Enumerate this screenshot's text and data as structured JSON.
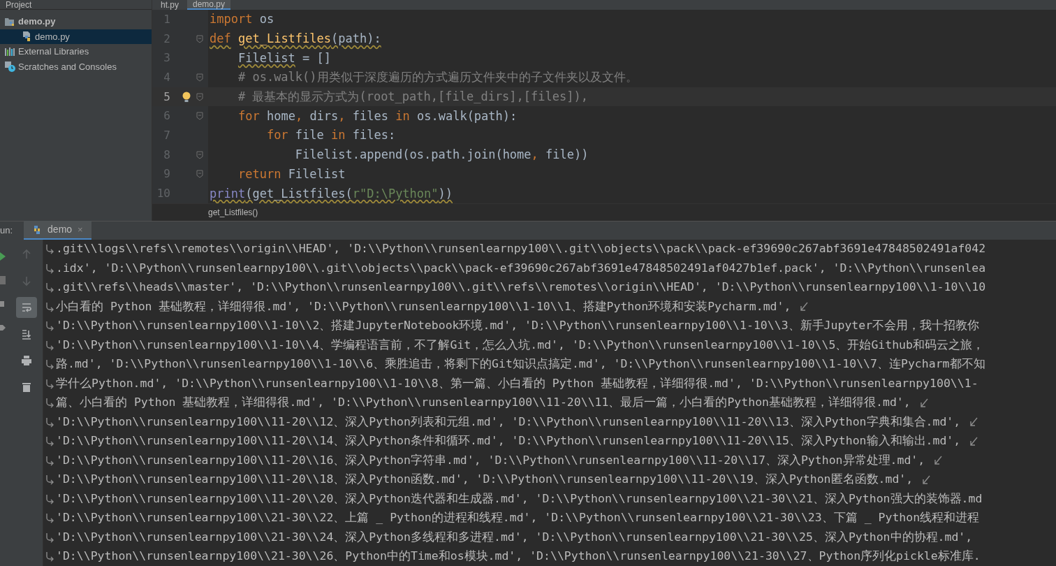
{
  "project_panel": {
    "title": "Project",
    "tree": [
      {
        "label": "demo.py",
        "kind": "folder",
        "selected": false,
        "children": [
          {
            "label": "demo.py",
            "kind": "python",
            "selected": true
          }
        ]
      },
      {
        "label": "External Libraries",
        "kind": "library",
        "selected": false
      },
      {
        "label": "Scratches and Consoles",
        "kind": "scratch",
        "selected": false
      }
    ]
  },
  "editor_tabs": [
    {
      "label": "ht.py",
      "selected": false
    },
    {
      "label": "demo.py",
      "selected": true
    }
  ],
  "code_lines": [
    {
      "number": "1",
      "current": false,
      "fold": false,
      "bulb": false,
      "tokens": [
        {
          "kind": "keyword",
          "text": "import",
          "warning": false
        },
        {
          "kind": "plain",
          "text": " os",
          "warning": false
        }
      ]
    },
    {
      "number": "2",
      "current": false,
      "fold": true,
      "bulb": false,
      "tokens": [
        {
          "kind": "keyword",
          "text": "def",
          "warning": true
        },
        {
          "kind": "function",
          "text": " get_Listfiles",
          "warning": true
        },
        {
          "kind": "plain",
          "text": "(path):",
          "warning": true
        }
      ]
    },
    {
      "number": "3",
      "current": false,
      "fold": false,
      "bulb": false,
      "tokens": [
        {
          "kind": "plain",
          "text": "    Filelist",
          "warning": true
        },
        {
          "kind": "plain",
          "text": " = []",
          "warning": false
        }
      ]
    },
    {
      "number": "4",
      "current": false,
      "fold": true,
      "bulb": false,
      "tokens": [
        {
          "kind": "comment",
          "text": "    # os.walk()用类似于深度遍历的方式遍历文件夹中的子文件夹以及文件。",
          "warning": false
        }
      ]
    },
    {
      "number": "5",
      "current": true,
      "fold": true,
      "bulb": true,
      "tokens": [
        {
          "kind": "comment",
          "text": "    # 最基本的显示方式为(root_path,[file_dirs],[files]),",
          "warning": false
        }
      ]
    },
    {
      "number": "6",
      "current": false,
      "fold": true,
      "bulb": false,
      "tokens": [
        {
          "kind": "keyword",
          "text": "    for",
          "warning": false
        },
        {
          "kind": "plain",
          "text": " home",
          "warning": false
        },
        {
          "kind": "keyword",
          "text": ",",
          "warning": false
        },
        {
          "kind": "plain",
          "text": " dirs",
          "warning": false
        },
        {
          "kind": "keyword",
          "text": ",",
          "warning": false
        },
        {
          "kind": "plain",
          "text": " files ",
          "warning": false
        },
        {
          "kind": "keyword",
          "text": "in",
          "warning": false
        },
        {
          "kind": "plain",
          "text": " os.walk(path):",
          "warning": false
        }
      ]
    },
    {
      "number": "7",
      "current": false,
      "fold": false,
      "bulb": false,
      "tokens": [
        {
          "kind": "keyword",
          "text": "        for",
          "warning": false
        },
        {
          "kind": "plain",
          "text": " file ",
          "warning": false
        },
        {
          "kind": "keyword",
          "text": "in",
          "warning": false
        },
        {
          "kind": "plain",
          "text": " files:",
          "warning": false
        }
      ]
    },
    {
      "number": "8",
      "current": false,
      "fold": true,
      "bulb": false,
      "tokens": [
        {
          "kind": "plain",
          "text": "            Filelist.append(os.path.join(home",
          "warning": false
        },
        {
          "kind": "keyword",
          "text": ",",
          "warning": false
        },
        {
          "kind": "plain",
          "text": " file))",
          "warning": false
        }
      ]
    },
    {
      "number": "9",
      "current": false,
      "fold": true,
      "bulb": false,
      "tokens": [
        {
          "kind": "keyword",
          "text": "    return",
          "warning": false
        },
        {
          "kind": "plain",
          "text": " Filelist",
          "warning": false
        }
      ]
    },
    {
      "number": "10",
      "current": false,
      "fold": false,
      "bulb": false,
      "tokens": [
        {
          "kind": "builtin",
          "text": "print",
          "warning": true
        },
        {
          "kind": "plain",
          "text": "(get_Listfiles(",
          "warning": true
        },
        {
          "kind": "string",
          "text": "r\"D:\\Python\"",
          "warning": true
        },
        {
          "kind": "plain",
          "text": "))",
          "warning": true
        }
      ]
    }
  ],
  "breadcrumb": "get_Listfiles()",
  "run_panel": {
    "label": "un:",
    "tab": "demo",
    "tab_close": "×",
    "toolbar": [
      {
        "kind": "up",
        "disabled": true,
        "selected": false
      },
      {
        "kind": "down",
        "disabled": true,
        "selected": false
      },
      {
        "kind": "wrap",
        "disabled": false,
        "selected": true
      },
      {
        "kind": "scroll-end",
        "disabled": false,
        "selected": false
      },
      {
        "kind": "print",
        "disabled": false,
        "selected": false
      },
      {
        "kind": "trash",
        "disabled": false,
        "selected": false
      }
    ],
    "output": [
      {
        "text": ".git\\\\logs\\\\refs\\\\remotes\\\\origin\\\\HEAD', 'D:\\\\Python\\\\runsenlearnpy100\\\\.git\\\\objects\\\\pack\\\\pack-ef39690c267abf3691e47848502491af042",
        "wrap_end": false
      },
      {
        "text": ".idx', 'D:\\\\Python\\\\runsenlearnpy100\\\\.git\\\\objects\\\\pack\\\\pack-ef39690c267abf3691e47848502491af0427b1ef.pack', 'D:\\\\Python\\\\runsenlea",
        "wrap_end": false
      },
      {
        "text": ".git\\\\refs\\\\heads\\\\master', 'D:\\\\Python\\\\runsenlearnpy100\\\\.git\\\\refs\\\\remotes\\\\origin\\\\HEAD', 'D:\\\\Python\\\\runsenlearnpy100\\\\1-10\\\\10",
        "wrap_end": false
      },
      {
        "text": "小白看的 Python 基础教程，详细得很.md', 'D:\\\\Python\\\\runsenlearnpy100\\\\1-10\\\\1、搭建Python环境和安装Pycharm.md', ",
        "wrap_end": true
      },
      {
        "text": "'D:\\\\Python\\\\runsenlearnpy100\\\\1-10\\\\2、搭建JupyterNotebook环境.md', 'D:\\\\Python\\\\runsenlearnpy100\\\\1-10\\\\3、新手Jupyter不会用，我十招教你",
        "wrap_end": false
      },
      {
        "text": "'D:\\\\Python\\\\runsenlearnpy100\\\\1-10\\\\4、学编程语言前，不了解Git，怎么入坑.md', 'D:\\\\Python\\\\runsenlearnpy100\\\\1-10\\\\5、开始Github和码云之旅，",
        "wrap_end": false
      },
      {
        "text": "路.md', 'D:\\\\Python\\\\runsenlearnpy100\\\\1-10\\\\6、乘胜追击，将剩下的Git知识点搞定.md', 'D:\\\\Python\\\\runsenlearnpy100\\\\1-10\\\\7、连Pycharm都不知",
        "wrap_end": false
      },
      {
        "text": "学什么Python.md', 'D:\\\\Python\\\\runsenlearnpy100\\\\1-10\\\\8、第一篇、小白看的 Python 基础教程，详细得很.md', 'D:\\\\Python\\\\runsenlearnpy100\\\\1-",
        "wrap_end": false
      },
      {
        "text": "篇、小白看的 Python 基础教程，详细得很.md', 'D:\\\\Python\\\\runsenlearnpy100\\\\11-20\\\\11、最后一篇，小白看的Python基础教程，详细得很.md', ",
        "wrap_end": true
      },
      {
        "text": "'D:\\\\Python\\\\runsenlearnpy100\\\\11-20\\\\12、深入Python列表和元组.md', 'D:\\\\Python\\\\runsenlearnpy100\\\\11-20\\\\13、深入Python字典和集合.md', ",
        "wrap_end": true
      },
      {
        "text": "'D:\\\\Python\\\\runsenlearnpy100\\\\11-20\\\\14、深入Python条件和循环.md', 'D:\\\\Python\\\\runsenlearnpy100\\\\11-20\\\\15、深入Python输入和输出.md', ",
        "wrap_end": true
      },
      {
        "text": "'D:\\\\Python\\\\runsenlearnpy100\\\\11-20\\\\16、深入Python字符串.md', 'D:\\\\Python\\\\runsenlearnpy100\\\\11-20\\\\17、深入Python异常处理.md', ",
        "wrap_end": true
      },
      {
        "text": "'D:\\\\Python\\\\runsenlearnpy100\\\\11-20\\\\18、深入Python函数.md', 'D:\\\\Python\\\\runsenlearnpy100\\\\11-20\\\\19、深入Python匿名函数.md', ",
        "wrap_end": true
      },
      {
        "text": "'D:\\\\Python\\\\runsenlearnpy100\\\\11-20\\\\20、深入Python迭代器和生成器.md', 'D:\\\\Python\\\\runsenlearnpy100\\\\21-30\\\\21、深入Python强大的装饰器.md",
        "wrap_end": false
      },
      {
        "text": "'D:\\\\Python\\\\runsenlearnpy100\\\\21-30\\\\22、上篇 _ Python的进程和线程.md', 'D:\\\\Python\\\\runsenlearnpy100\\\\21-30\\\\23、下篇 _ Python线程和进程",
        "wrap_end": false
      },
      {
        "text": "'D:\\\\Python\\\\runsenlearnpy100\\\\21-30\\\\24、深入Python多线程和多进程.md', 'D:\\\\Python\\\\runsenlearnpy100\\\\21-30\\\\25、深入Python中的协程.md', ",
        "wrap_end": false
      },
      {
        "text": "'D:\\\\Python\\\\runsenlearnpy100\\\\21-30\\\\26、Python中的Time和os模块.md', 'D:\\\\Python\\\\runsenlearnpy100\\\\21-30\\\\27、Python序列化pickle标准库.",
        "wrap_end": false
      }
    ]
  }
}
